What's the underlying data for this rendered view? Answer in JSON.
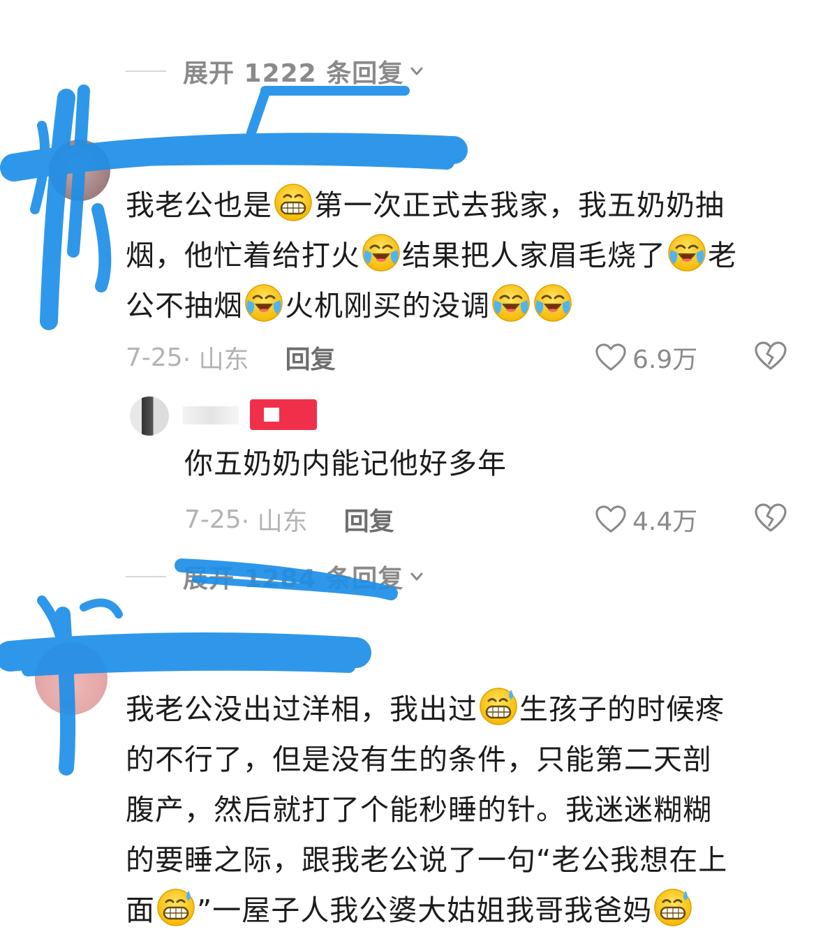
{
  "thread1": {
    "expand_label": "展开 1222 条回复"
  },
  "comment1": {
    "lines": [
      [
        "我老公也是",
        "[emoji:grin]",
        "第一次正式去我家，我五奶奶抽"
      ],
      [
        "烟，他忙着给打火",
        "[emoji:cry]",
        "结果把人家眉毛烧了",
        "[emoji:cry]",
        "老"
      ],
      [
        "公不抽烟",
        "[emoji:cry]",
        "火机刚买的没调",
        "[emoji:cry]",
        "[emoji:cry]"
      ]
    ],
    "line1a": "我老公也是",
    "line1b": "第一次正式去我家，我五奶奶抽",
    "line2a": "烟，他忙着给打火",
    "line2b": "结果把人家眉毛烧了",
    "line2c": "老",
    "line3a": "公不抽烟",
    "line3b": "火机刚买的没调",
    "date": "7-25",
    "location": "· 山东",
    "reply_label": "回复",
    "likes": "6.9万"
  },
  "reply1": {
    "text": "你五奶奶内能记他好多年",
    "date": "7-25",
    "location": "· 山东",
    "reply_label": "回复",
    "likes": "4.4万"
  },
  "thread2": {
    "expand_label": "展开 1284 条回复"
  },
  "comment2": {
    "line1a": "我老公没出过洋相，我出过",
    "line1b": "生孩子的时候疼",
    "line2": "的不行了，但是没有生的条件，只能第二天剖",
    "line3": "腹产，然后就打了个能秒睡的针。我迷迷糊糊",
    "line4": "的要睡之际，跟我老公说了一句“老公我想在上",
    "line5a": "面",
    "line5b": "”一屋子人我公婆大姑姐我哥我爸妈"
  },
  "icons": {
    "emoji_grin": "grin-emoji",
    "emoji_cry": "laugh-cry-emoji",
    "emoji_sweat": "sweat-grin-emoji",
    "like": "heart-outline-icon",
    "dislike": "broken-heart-icon",
    "chevron": "chevron-down-icon"
  },
  "colors": {
    "scribble": "#1e8fe8",
    "meta_gray": "#b3b3b3",
    "reply_gray": "#6e6e6e",
    "badge_red": "#f0304a"
  }
}
